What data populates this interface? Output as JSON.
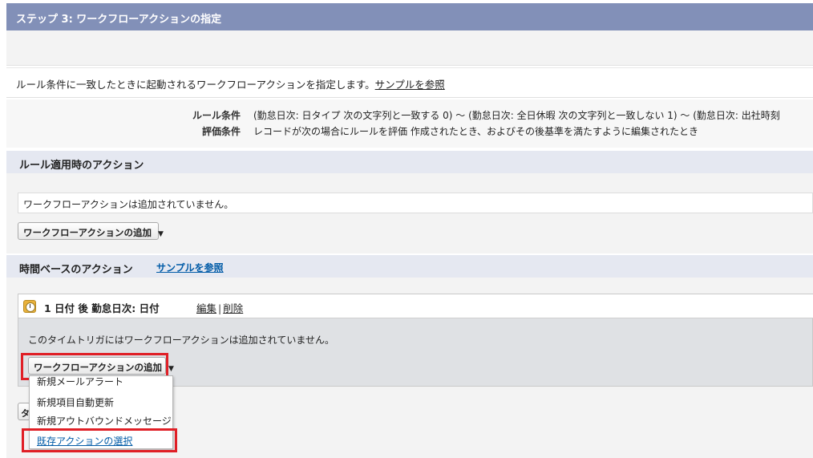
{
  "step": {
    "title": "ステップ 3: ワークフローアクションの指定"
  },
  "intro": {
    "text": "ルール条件に一致したときに起動されるワークフローアクションを指定します。",
    "link": "サンプルを参照"
  },
  "rule": {
    "criteria_label": "ルール条件",
    "criteria_value": "(勤怠日次: 日タイプ 次の文字列と一致する 0) ～ (勤怠日次: 全日休暇 次の文字列と一致しない 1) ～ (勤怠日次: 出社時刻",
    "evaluation_label": "評価条件",
    "evaluation_value": "レコードが次の場合にルールを評価 作成されたとき、およびその後基準を満たすように編集されたとき"
  },
  "immediate": {
    "title": "ルール適用時のアクション",
    "empty_text": "ワークフローアクションは追加されていません。",
    "add_button": "ワークフローアクションの追加"
  },
  "time_based": {
    "title": "時間ベースのアクション",
    "link": "サンプルを参照",
    "trigger": {
      "title": "1 日付 後 勤怠日次: 日付",
      "edit": "編集",
      "separator": "|",
      "delete": "削除",
      "empty_text": "このタイムトリガにはワークフローアクションは追加されていません。",
      "add_button": "ワークフローアクションの追加"
    },
    "hidden_button": "タ"
  },
  "dropdown": {
    "items": [
      "新規メールアラート",
      "新規項目自動更新",
      "新規アウトバウンドメッセージ",
      "既存アクションの選択"
    ]
  },
  "icons": {
    "caret": "▼",
    "clock": "clock-icon"
  },
  "colors": {
    "header_bg": "#8290b8",
    "highlight_border": "#e01f26",
    "link": "#015ba7"
  }
}
